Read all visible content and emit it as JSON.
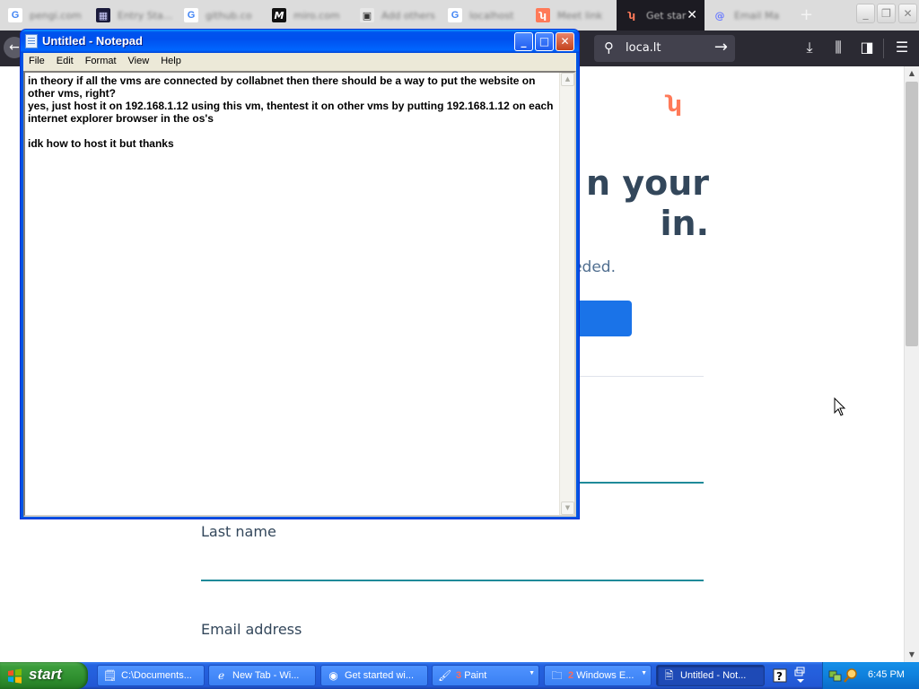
{
  "browser": {
    "tabs": [
      {
        "title": "pengi.com",
        "favicon": "g-icon",
        "active": false
      },
      {
        "title": "Entry Sta...",
        "favicon": "site-icon",
        "active": false
      },
      {
        "title": "github.co",
        "favicon": "g-icon",
        "active": false
      },
      {
        "title": "miro.com",
        "favicon": "m-icon",
        "active": false
      },
      {
        "title": "Add others",
        "favicon": "pc-icon",
        "active": false
      },
      {
        "title": "localhost",
        "favicon": "g-icon",
        "active": false
      },
      {
        "title": "Meet link",
        "favicon": "hubspot-icon",
        "active": false
      },
      {
        "title": "Get star",
        "favicon": "hubspot-icon",
        "active": true
      },
      {
        "title": "Email Ma",
        "favicon": "at-icon",
        "active": false
      }
    ],
    "url": "loca.lt"
  },
  "page": {
    "headline_line1": "n your",
    "headline_line2": "in.",
    "subhead": "eded.",
    "last_name_label": "Last name",
    "email_label": "Email address"
  },
  "notepad": {
    "title": "Untitled - Notepad",
    "menu": [
      "File",
      "Edit",
      "Format",
      "View",
      "Help"
    ],
    "lines": [
      "in theory if all the vms are connected by collabnet then there should be a way to put the website on other vms, right?",
      "yes, just host it on 192.168.1.12 using this vm, thentest it on other vms by putting 192.168.1.12 on each internet explorer browser in the os's",
      "",
      "idk how to host it but thanks"
    ]
  },
  "taskbar": {
    "start_label": "start",
    "tasks": [
      {
        "label": "C:\\Documents...",
        "icon": "folder-note-icon",
        "count": "",
        "active": false,
        "dropdown": false
      },
      {
        "label": "New Tab - Wi...",
        "icon": "ie-icon",
        "count": "",
        "active": false,
        "dropdown": false
      },
      {
        "label": "Get started wi...",
        "icon": "firefox-icon",
        "count": "",
        "active": false,
        "dropdown": false
      },
      {
        "label": "Paint",
        "icon": "paint-icon",
        "count": "3",
        "active": false,
        "dropdown": true
      },
      {
        "label": "Windows E...",
        "icon": "folder-icon",
        "count": "2",
        "active": false,
        "dropdown": true
      },
      {
        "label": "Untitled - Not...",
        "icon": "notepad-icon",
        "count": "",
        "active": true,
        "dropdown": false
      }
    ],
    "clock": "6:45 PM"
  },
  "colors": {
    "xp_blue": "#245edb",
    "start_green": "#3c9d3c",
    "hubspot_orange": "#ff7a59",
    "firefox_toolbar": "#2b2a33"
  }
}
